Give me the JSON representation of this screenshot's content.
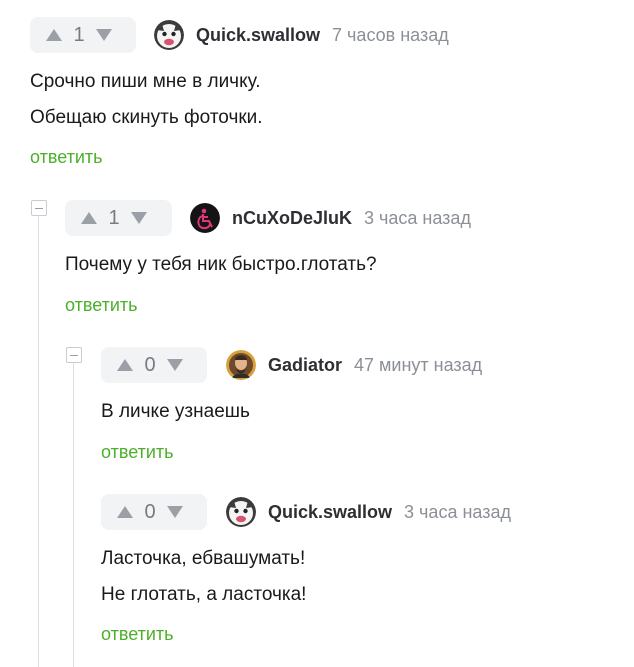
{
  "comments": [
    {
      "rating": "1",
      "username": "Quick.swallow",
      "time": "7 часов назад",
      "lines": [
        "Срочно пиши мне в личку.",
        "Обещаю скинуть фоточки."
      ],
      "reply": "ответить",
      "avatar_icon": "pug-avatar-icon"
    },
    {
      "rating": "1",
      "username": "nCuXoDeJluK",
      "time": "3 часа назад",
      "lines": [
        "Почему у тебя ник быстро.глотать?"
      ],
      "reply": "ответить",
      "avatar_icon": "wheelchair-avatar-icon"
    },
    {
      "rating": "0",
      "username": "Gadiator",
      "time": "47 минут назад",
      "lines": [
        "В личке узнаешь"
      ],
      "reply": "ответить",
      "avatar_icon": "portrait-avatar-icon"
    },
    {
      "rating": "0",
      "username": "Quick.swallow",
      "time": "3 часа назад",
      "lines": [
        "Ласточка, ебвашумать!",
        "Не глотать, а ласточка!"
      ],
      "reply": "ответить",
      "avatar_icon": "pug-avatar-icon"
    }
  ],
  "colors": {
    "reply_link": "#4caf2a",
    "vote_arrow": "#9aa0a6",
    "rating_bg": "#f2f3f5",
    "thread_line": "#dcdfe3"
  }
}
